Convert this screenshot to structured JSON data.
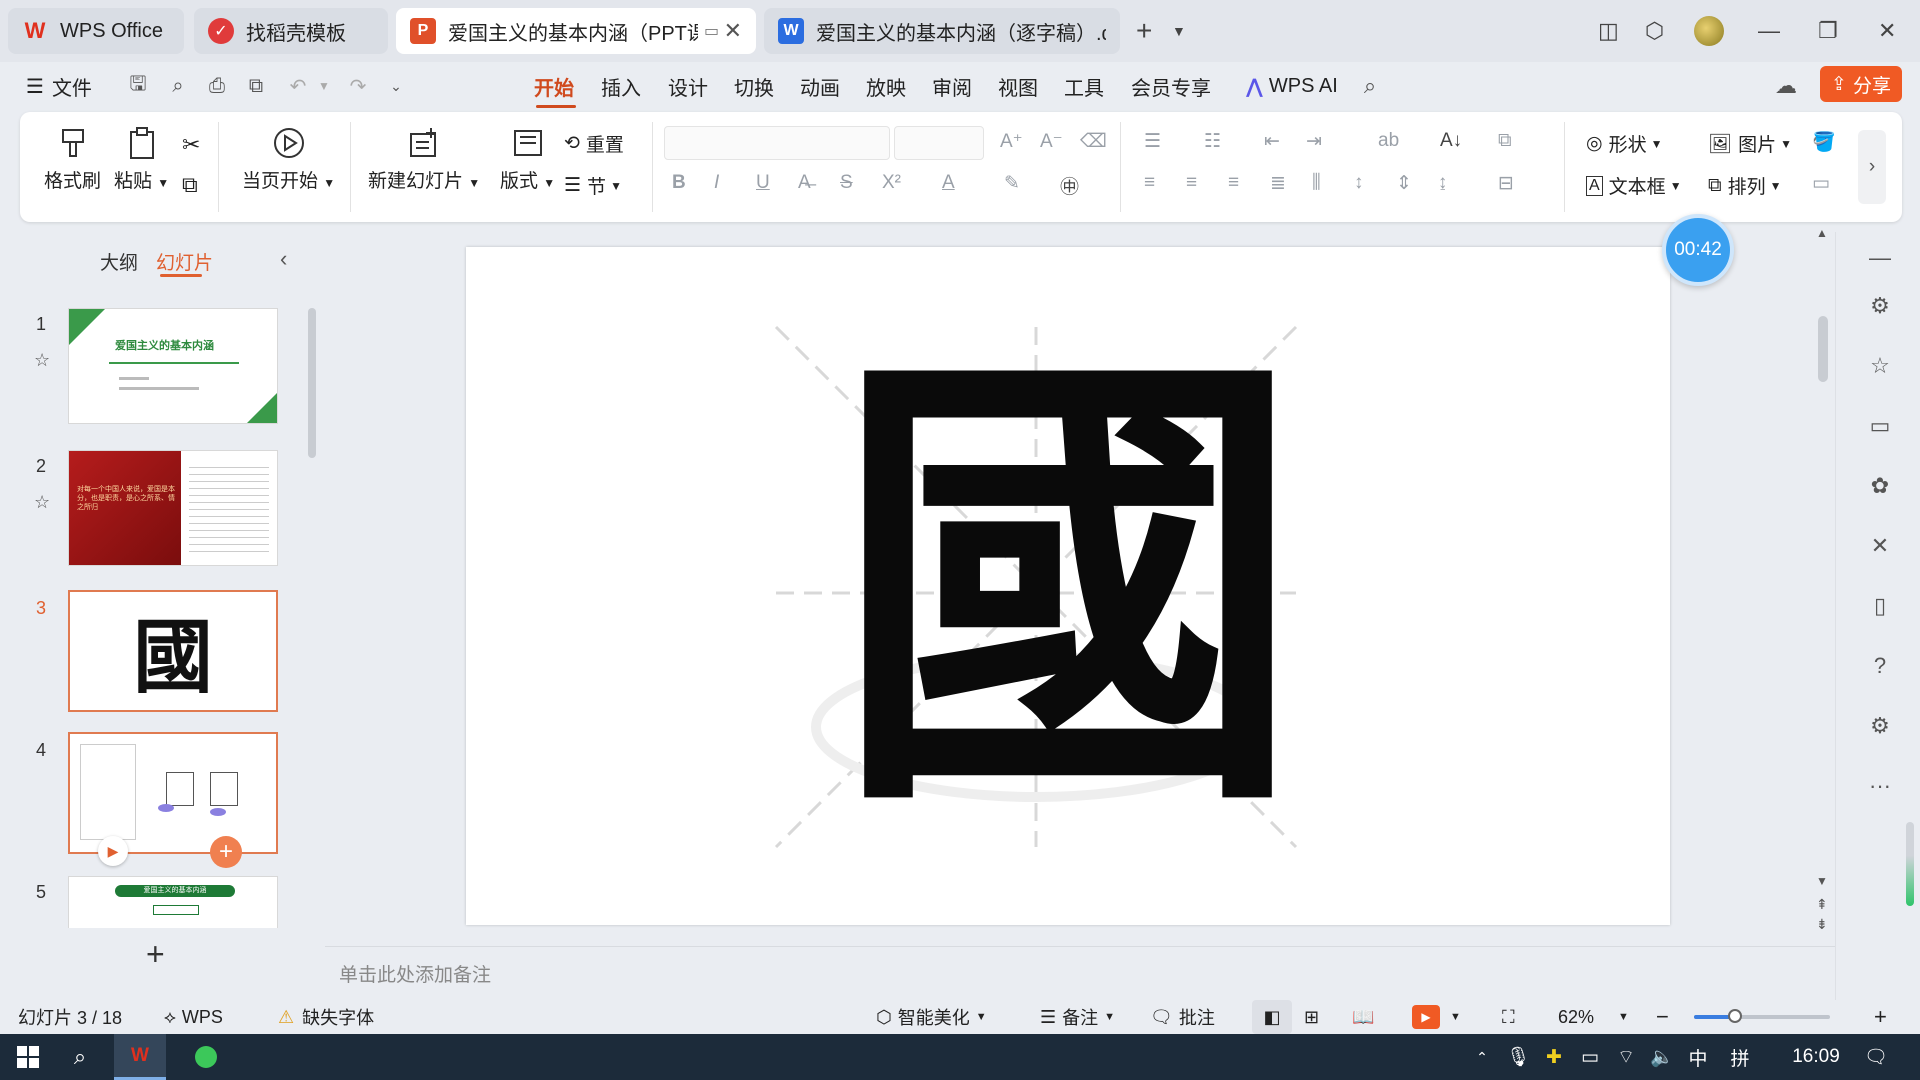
{
  "tabs": [
    {
      "label": "WPS Office",
      "icon": "wps-logo-icon"
    },
    {
      "label": "找稻壳模板",
      "icon": "docer-icon"
    },
    {
      "label": "爱国主义的基本内涵（PPT课件",
      "icon": "ppt-icon",
      "active": true
    },
    {
      "label": "爱国主义的基本内涵（逐字稿）.docx",
      "icon": "word-icon"
    }
  ],
  "menu": {
    "file": "文件",
    "items": [
      "开始",
      "插入",
      "设计",
      "切换",
      "动画",
      "放映",
      "审阅",
      "视图",
      "工具",
      "会员专享"
    ],
    "active": "开始",
    "wps_ai": "WPS AI",
    "share": "分享"
  },
  "ribbon": {
    "format_painter": "格式刷",
    "paste": "粘贴",
    "play_from_current": "当页开始",
    "new_slide": "新建幻灯片",
    "layout": "版式",
    "reset": "重置",
    "section": "节",
    "shape": "形状",
    "picture": "图片",
    "textbox": "文本框",
    "arrange": "排列"
  },
  "left_panel": {
    "tab_outline": "大纲",
    "tab_slides": "幻灯片",
    "active_tab": "幻灯片",
    "slides": [
      {
        "num": "1",
        "title": "爱国主义的基本内涵"
      },
      {
        "num": "2",
        "title": "对每一个中国人来说，爱国是本分，也是职责，是心之所系、情之所归"
      },
      {
        "num": "3",
        "title": "國",
        "selected": true
      },
      {
        "num": "4",
        "title": ""
      },
      {
        "num": "5",
        "title": "爱国主义的基本内涵"
      }
    ]
  },
  "slide": {
    "character": "國"
  },
  "timer": "00:42",
  "notes_placeholder": "单击此处添加备注",
  "status": {
    "slide_counter": "幻灯片 3 / 18",
    "wps": "WPS",
    "missing_font": "缺失字体",
    "smart_beautify": "智能美化",
    "notes": "备注",
    "comments": "批注",
    "zoom": "62%",
    "zoom_fraction": 0.3
  },
  "taskbar": {
    "time": "16:09",
    "ime": "中"
  },
  "colors": {
    "accent": "#d04a1e",
    "share": "#f05a24",
    "timer": "#3aa0f0",
    "taskbar": "#1c2b3a"
  }
}
